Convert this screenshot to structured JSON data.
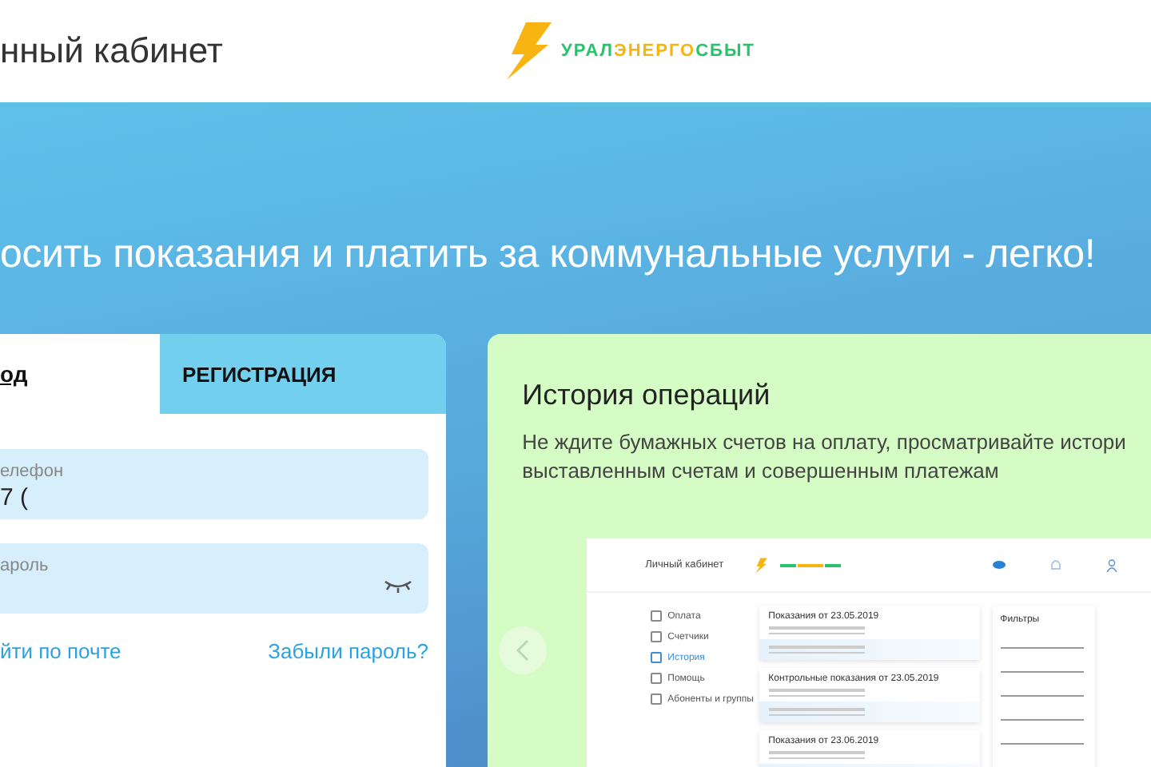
{
  "header": {
    "title": "нный кабинет",
    "logo": [
      {
        "text": "УРАЛ",
        "color": "#27c36b"
      },
      {
        "text": "ЭНЕРГО",
        "color": "#f5b50c"
      },
      {
        "text": "СБЫТ",
        "color": "#27c36b"
      }
    ]
  },
  "hero": {
    "headline": "осить показания и платить за коммунальные услуги - легко!"
  },
  "login": {
    "tabs": [
      {
        "label": "од",
        "selected": true
      },
      {
        "label": "РЕГИСТРАЦИЯ",
        "selected": false
      }
    ],
    "fields": [
      {
        "kind": "text",
        "label": "елефон",
        "value": "7 ("
      },
      {
        "kind": "password",
        "label": "ароль"
      }
    ],
    "links": [
      "йти по почте",
      "Забыли пароль?"
    ]
  },
  "promo": {
    "title": "История операций",
    "desc_lines": [
      "Не ждите бумажных счетов на оплату, просматривайте истори",
      "выставленным счетам и совершенным платежам"
    ],
    "preview": {
      "title": "Личный кабинет",
      "nav": [
        {
          "label": "Оплата",
          "selected": false
        },
        {
          "label": "Счетчики",
          "selected": false
        },
        {
          "label": "История",
          "selected": true
        },
        {
          "label": "Помощь",
          "selected": false
        },
        {
          "label": "Абоненты и группы",
          "selected": false
        }
      ],
      "cards": [
        {
          "title": "Показания от 23.05.2019"
        },
        {
          "title": "Контрольные показания от 23.05.2019"
        },
        {
          "title": "Показания от 23.06.2019"
        }
      ],
      "filters_title": "Фильтры"
    }
  }
}
